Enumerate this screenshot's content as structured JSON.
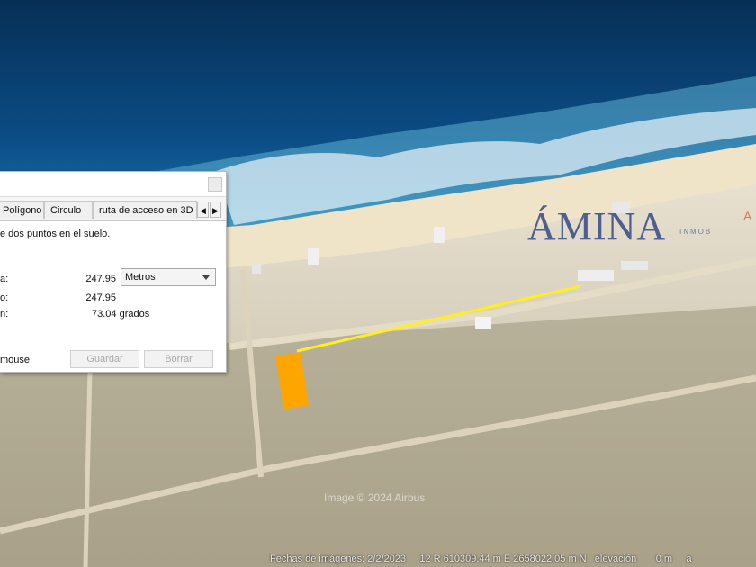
{
  "ruler": {
    "tabs": [
      "Polígono",
      "Circulo",
      "ruta de acceso en 3D"
    ],
    "description": "e dos puntos en el suelo.",
    "rows": [
      {
        "label": "a:",
        "value": "247.95"
      },
      {
        "label": "o:",
        "value": "247.95"
      },
      {
        "label": "n:",
        "value": "73.04 grados"
      }
    ],
    "units": "Metros",
    "mouse_label": "mouse",
    "save_label": "Guardar",
    "clear_label": "Borrar"
  },
  "status": {
    "imagery_date": "Fechas de imágenes: 2/2/2023",
    "coordinates": "12 R 610309.44 m E 2658022.05 m N",
    "elevation": "elevación",
    "trailing": "0 m",
    "tail": "a"
  },
  "watermark": "Image © 2024 Airbus",
  "brand": {
    "name": "ÁMINA",
    "sub": "INMOB",
    "mark": "A"
  },
  "colors": {
    "ocean": "#0a3f73",
    "sand": "#d8cfba",
    "parcel": "#ffa500",
    "measure_line": "#ffee22"
  }
}
